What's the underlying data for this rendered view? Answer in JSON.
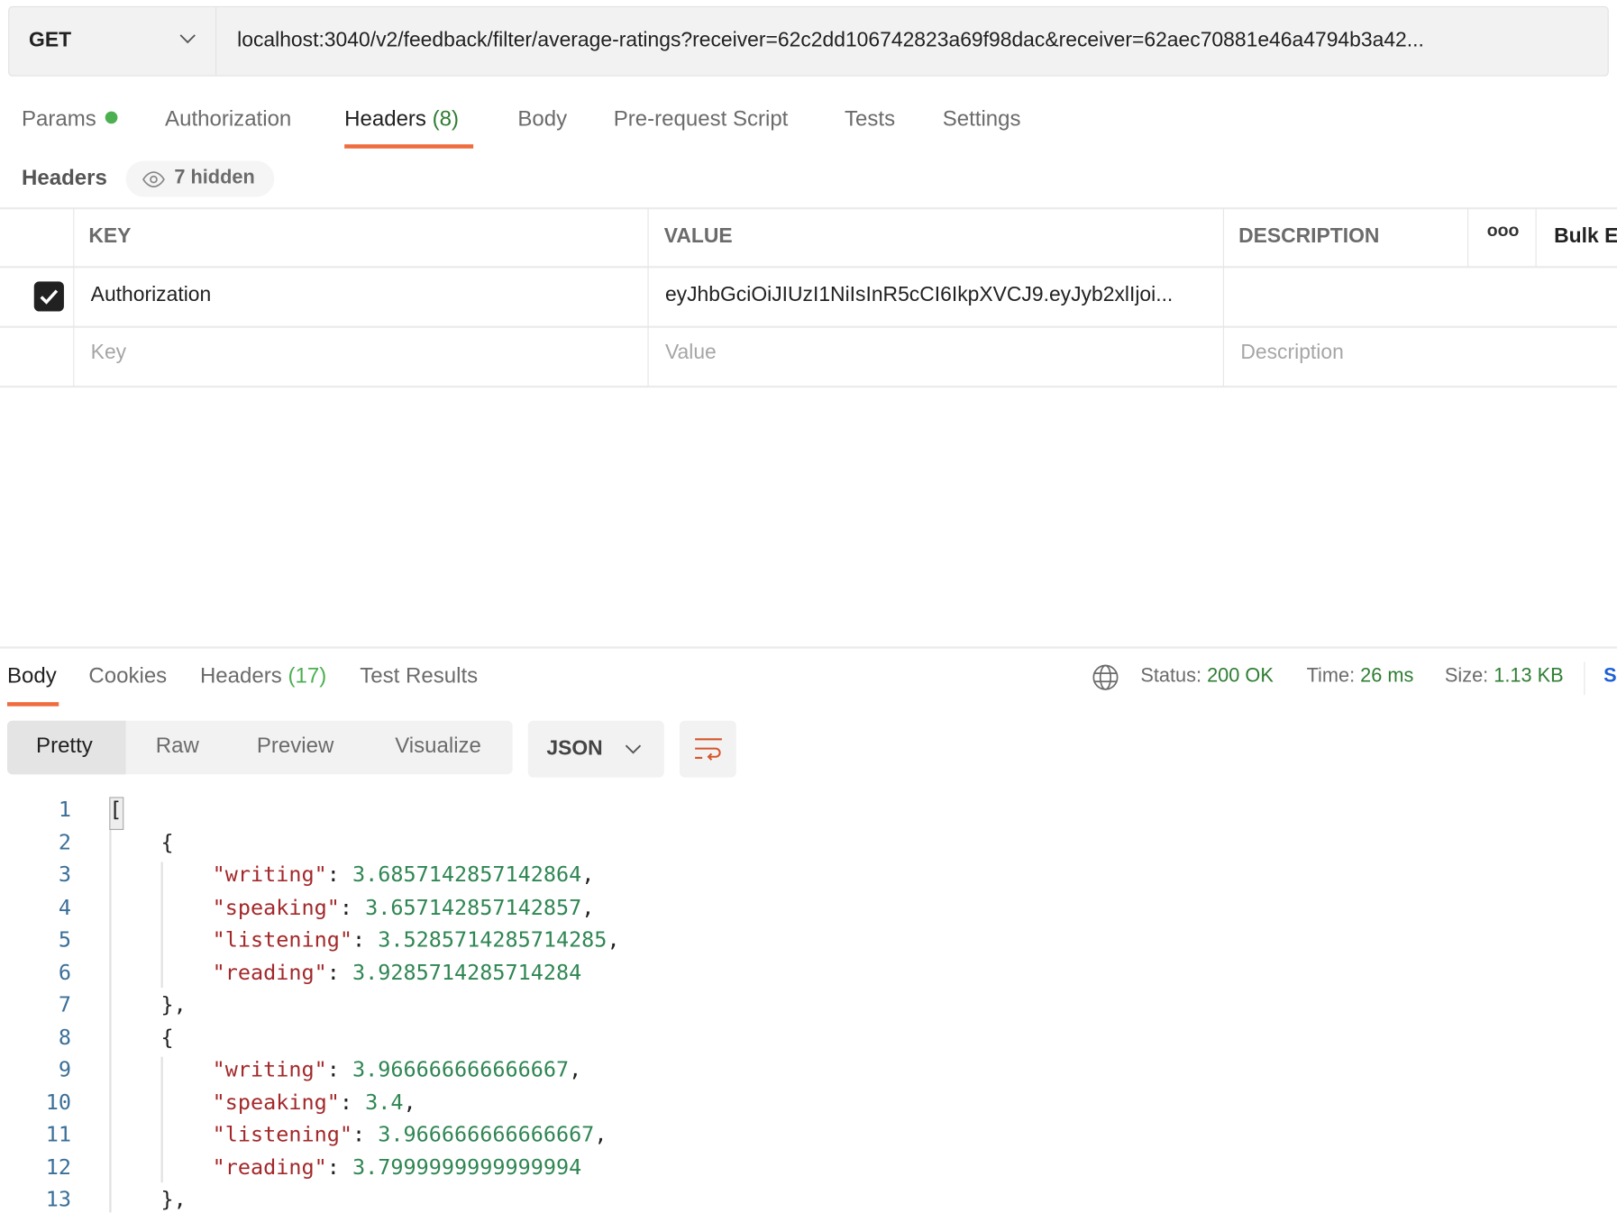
{
  "request": {
    "method": "GET",
    "url": "localhost:3040/v2/feedback/filter/average-ratings?receiver=62c2dd106742823a69f98dac&receiver=62aec70881e46a4794b3a42..."
  },
  "request_tabs": [
    {
      "label": "Params",
      "dot_color": "#4caf50"
    },
    {
      "label": "Authorization"
    },
    {
      "label": "Headers",
      "count": "(8)",
      "active": true
    },
    {
      "label": "Body"
    },
    {
      "label": "Pre-request Script"
    },
    {
      "label": "Tests"
    },
    {
      "label": "Settings"
    }
  ],
  "headers_section": {
    "label": "Headers",
    "hidden_label": "7 hidden",
    "hidden_icon": "eye-icon"
  },
  "table": {
    "columns": [
      "KEY",
      "VALUE",
      "DESCRIPTION"
    ],
    "more_icon": "ooo",
    "bulk_edit_label": "Bulk E",
    "rows": [
      {
        "checked": true,
        "key": "Authorization",
        "value": "eyJhbGciOiJIUzI1NiIsInR5cCI6IkpXVCJ9.eyJyb2xlIjoi...",
        "description": ""
      }
    ],
    "placeholders": {
      "key": "Key",
      "value": "Value",
      "description": "Description"
    }
  },
  "response_tabs": [
    {
      "label": "Body",
      "active": true
    },
    {
      "label": "Cookies"
    },
    {
      "label": "Headers",
      "count": "(17)"
    },
    {
      "label": "Test Results"
    }
  ],
  "response_meta": {
    "status_label": "Status:",
    "status_value": "200 OK",
    "time_label": "Time:",
    "time_value": "26 ms",
    "size_label": "Size:",
    "size_value": "1.13 KB",
    "save_truncated": "S"
  },
  "view_modes": [
    "Pretty",
    "Raw",
    "Preview",
    "Visualize"
  ],
  "format": "JSON",
  "colors": {
    "accent": "#ef6c3f",
    "success": "#2e7d32",
    "json_key": "#a3282a",
    "json_number": "#2f8653",
    "line_number": "#3a6f99"
  },
  "code_lines": [
    {
      "n": "1",
      "indent": 0,
      "text": "["
    },
    {
      "n": "2",
      "indent": 1,
      "text": "{"
    },
    {
      "n": "3",
      "indent": 2,
      "key": "\"writing\"",
      "value": "3.6857142857142864",
      "comma": ","
    },
    {
      "n": "4",
      "indent": 2,
      "key": "\"speaking\"",
      "value": "3.657142857142857",
      "comma": ","
    },
    {
      "n": "5",
      "indent": 2,
      "key": "\"listening\"",
      "value": "3.5285714285714285",
      "comma": ","
    },
    {
      "n": "6",
      "indent": 2,
      "key": "\"reading\"",
      "value": "3.9285714285714284",
      "comma": ""
    },
    {
      "n": "7",
      "indent": 1,
      "text": "},"
    },
    {
      "n": "8",
      "indent": 1,
      "text": "{"
    },
    {
      "n": "9",
      "indent": 2,
      "key": "\"writing\"",
      "value": "3.966666666666667",
      "comma": ","
    },
    {
      "n": "10",
      "indent": 2,
      "key": "\"speaking\"",
      "value": "3.4",
      "comma": ","
    },
    {
      "n": "11",
      "indent": 2,
      "key": "\"listening\"",
      "value": "3.966666666666667",
      "comma": ","
    },
    {
      "n": "12",
      "indent": 2,
      "key": "\"reading\"",
      "value": "3.7999999999999994",
      "comma": ""
    },
    {
      "n": "13",
      "indent": 1,
      "text": "},"
    }
  ]
}
